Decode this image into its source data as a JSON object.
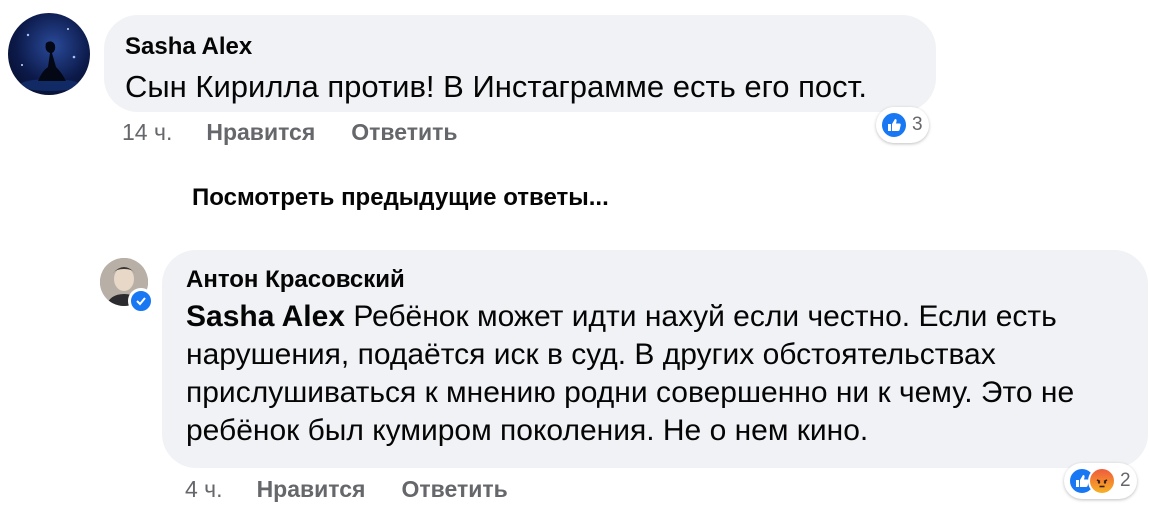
{
  "comment": {
    "author": "Sasha Alex",
    "text": "Сын Кирилла против! В Инстаграмме есть его пост.",
    "time": "14 ч.",
    "like_label": "Нравится",
    "reply_label": "Ответить",
    "reactions": {
      "icons": [
        "like-icon"
      ],
      "count": "3"
    }
  },
  "view_previous_replies": "Посмотреть предыдущие ответы...",
  "reply": {
    "author": "Антон Красовский",
    "verified": true,
    "mention": "Sasha Alex",
    "text": " Ребёнок может идти нахуй если честно. Если есть нарушения, подаётся иск в суд. В других обстоятельствах прислушиваться к мнению родни совершенно ни к чему. Это не ребёнок был кумиром поколения. Не о нем кино.",
    "time": "4 ч.",
    "like_label": "Нравится",
    "reply_label": "Ответить",
    "reactions": {
      "icons": [
        "like-icon",
        "angry-icon"
      ],
      "count": "2"
    }
  },
  "colors": {
    "bubble": "#f0f2f5",
    "meta_text": "#65676b",
    "like_blue": "#1877f2"
  }
}
